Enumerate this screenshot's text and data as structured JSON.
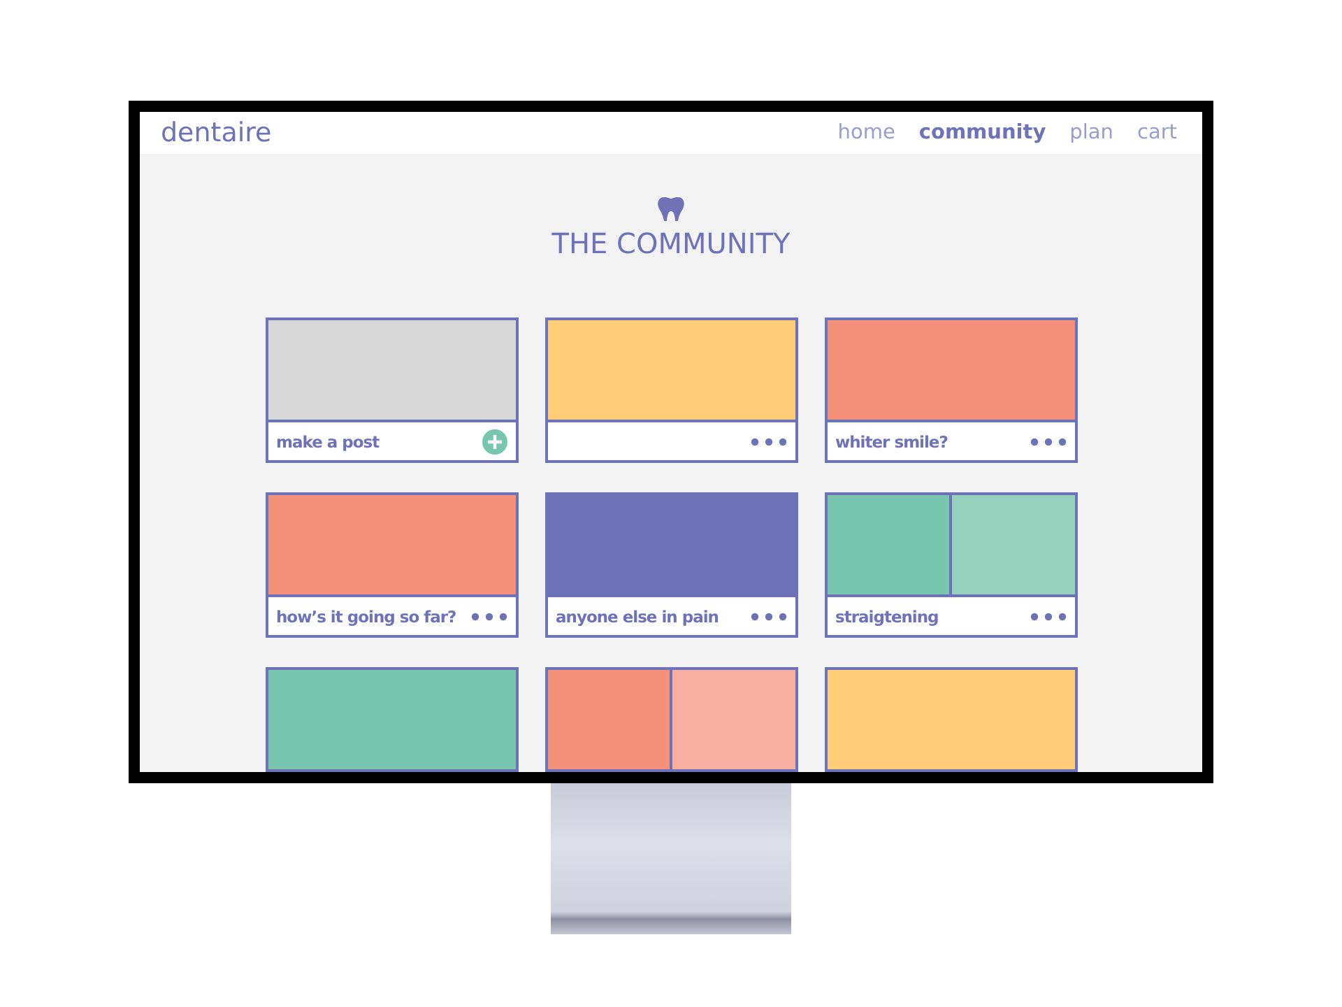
{
  "site": {
    "logo": "dentaire",
    "nav": [
      {
        "label": "home",
        "selected": false
      },
      {
        "label": "community",
        "selected": true
      },
      {
        "label": "plan",
        "selected": false
      },
      {
        "label": "cart",
        "selected": false
      }
    ]
  },
  "page": {
    "title": "THE COMMUNITY"
  },
  "cards": [
    {
      "panels": [
        {
          "color": "#d9d9d9"
        }
      ],
      "footer": {
        "title": "make a post",
        "kind": "add"
      }
    },
    {
      "panels": [
        {
          "color": "#ffcd78"
        }
      ],
      "footer": {
        "kind": "more"
      }
    },
    {
      "panels": [
        {
          "color": "#f5917b"
        }
      ],
      "footer": {
        "title": "whiter smile?",
        "kind": "more"
      }
    },
    {
      "panels": [
        {
          "color": "#f5917b"
        }
      ],
      "footer": {
        "title": "how’s it going so far?",
        "kind": "more"
      }
    },
    {
      "panels": [
        {
          "color": "#6e72b6"
        }
      ],
      "footer": {
        "title": "anyone else in pain",
        "kind": "more"
      }
    },
    {
      "panels": [
        {
          "color": "#78c6ae"
        },
        {
          "color": "#95d1bd"
        }
      ],
      "footer": {
        "title": "straigtening",
        "kind": "more"
      }
    },
    {
      "panels": [
        {
          "color": "#78c6ae"
        }
      ]
    },
    {
      "panels": [
        {
          "color": "#f5917b"
        },
        {
          "color": "#f8afa1"
        }
      ]
    },
    {
      "panels": [
        {
          "color": "#ffcd78"
        }
      ]
    }
  ]
}
